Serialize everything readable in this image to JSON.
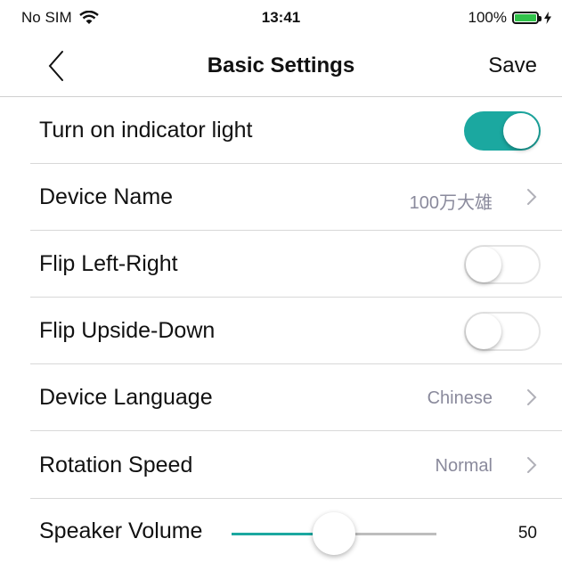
{
  "status_bar": {
    "carrier": "No SIM",
    "time": "13:41",
    "battery": "100%",
    "wifi_icon": "wifi-icon",
    "battery_color": "#31c24a"
  },
  "nav": {
    "title": "Basic Settings",
    "save_label": "Save",
    "back_icon": "chevron-left-icon"
  },
  "settings": {
    "indicator_light": {
      "label": "Turn on indicator light",
      "enabled": true
    },
    "device_name": {
      "label": "Device Name",
      "value": "100万大雄"
    },
    "flip_left_right": {
      "label": "Flip Left-Right",
      "enabled": false
    },
    "flip_upside_down": {
      "label": "Flip Upside-Down",
      "enabled": false
    },
    "device_language": {
      "label": "Device Language",
      "value": "Chinese"
    },
    "rotation_speed": {
      "label": "Rotation Speed",
      "value": "Normal"
    },
    "speaker_volume": {
      "label": "Speaker Volume",
      "value": "50",
      "level": 0.5
    }
  },
  "colors": {
    "accent": "#1ba8a0",
    "secondary_text": "#8a8a9c"
  }
}
